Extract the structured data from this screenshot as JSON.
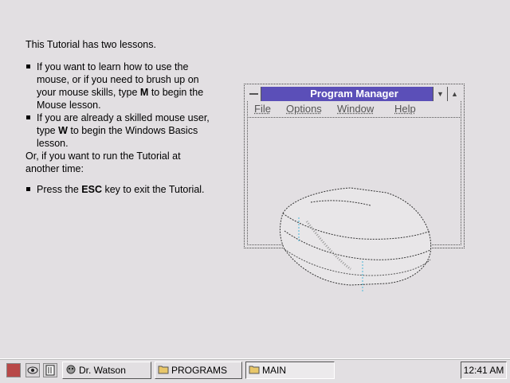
{
  "tutorial": {
    "intro": "This Tutorial has two lessons.",
    "bullet1": {
      "pre": "If you want to learn how to use the mouse, or if you need to brush up on your mouse skills, type ",
      "key": "M",
      "post": " to begin the Mouse lesson."
    },
    "bullet2": {
      "pre": "If you are already a skilled mouse user, type ",
      "key": "W",
      "post": " to begin the Windows Basics lesson."
    },
    "or_text": "Or, if you want to run the Tutorial at another time:",
    "bullet3": {
      "pre": "Press the ",
      "key": "ESC",
      "post": " key to exit the Tutorial."
    }
  },
  "program_manager": {
    "title": "Program Manager",
    "menus": {
      "file": "File",
      "options": "Options",
      "window": "Window",
      "help": "Help"
    }
  },
  "taskbar": {
    "tasks": [
      {
        "label": "Dr. Watson",
        "icon": "dr-watson-icon"
      },
      {
        "label": "PROGRAMS",
        "icon": "folder-icon"
      },
      {
        "label": "MAIN",
        "icon": "folder-icon",
        "active": true
      }
    ],
    "clock": "12:41 AM"
  },
  "colors": {
    "desktop": "#e2dfe2",
    "titlebar": "#5b4fb8"
  }
}
